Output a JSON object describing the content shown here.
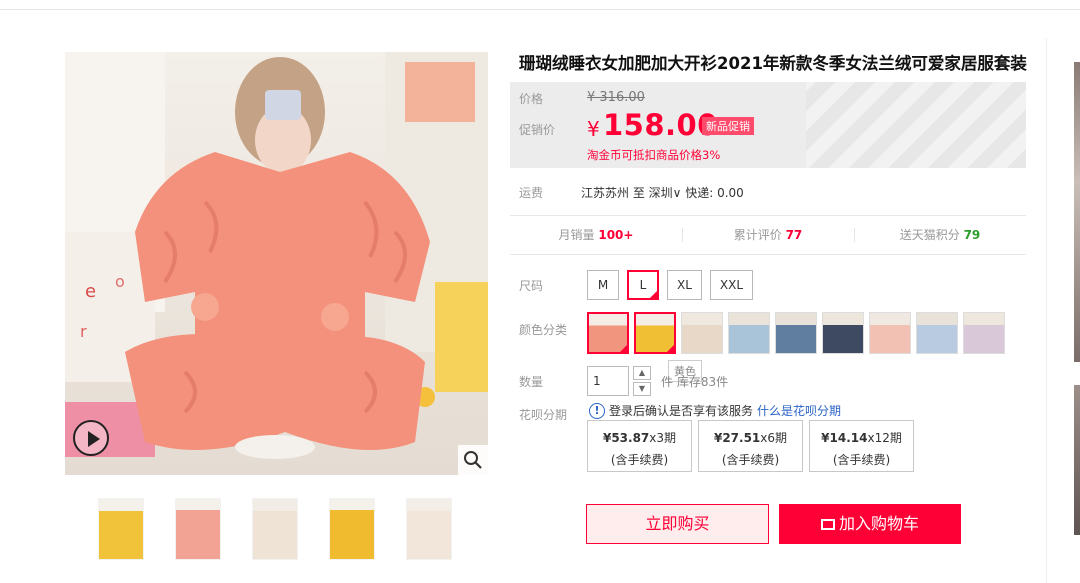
{
  "product": {
    "title": "珊瑚绒睡衣女加肥加大开衫2021年新款冬季女法兰绒可爱家居服套装"
  },
  "price": {
    "label": "价格",
    "original": "¥ 316.00",
    "promo_label": "促销价",
    "currency": "¥",
    "promo_value": "158.00",
    "badge": "新品促销",
    "coin_note": "淘金币可抵扣商品价格3%"
  },
  "shipping": {
    "label": "运费",
    "detail": "江苏苏州  至  深圳∨ 快递: 0.00"
  },
  "stats": {
    "monthly_label": "月销量",
    "monthly_value": "100+",
    "reviews_label": "累计评价",
    "reviews_value": "77",
    "points_label": "送天猫积分",
    "points_value": "79"
  },
  "size": {
    "label": "尺码",
    "options": [
      "M",
      "L",
      "XL",
      "XXL"
    ],
    "selected": "L"
  },
  "color": {
    "label": "颜色分类",
    "tooltip": "黄色"
  },
  "quantity": {
    "label": "数量",
    "value": "1",
    "stock_text": "件    库存83件"
  },
  "huabei": {
    "label": "花呗分期",
    "info_text": "登录后确认是否享有该服务",
    "link_text": "什么是花呗分期",
    "options": [
      {
        "amount": "¥53.87",
        "term": "x3期",
        "fee": "(含手续费)"
      },
      {
        "amount": "¥27.51",
        "term": "x6期",
        "fee": "(含手续费)"
      },
      {
        "amount": "¥14.14",
        "term": "x12期",
        "fee": "(含手续费)"
      }
    ]
  },
  "actions": {
    "buy_now": "立即购买",
    "add_cart": "加入购物车"
  },
  "colors": {
    "accent": "#ff0036",
    "badge": "#ff4c6c",
    "link": "#2b64c8",
    "price_bg": "#ececec"
  }
}
